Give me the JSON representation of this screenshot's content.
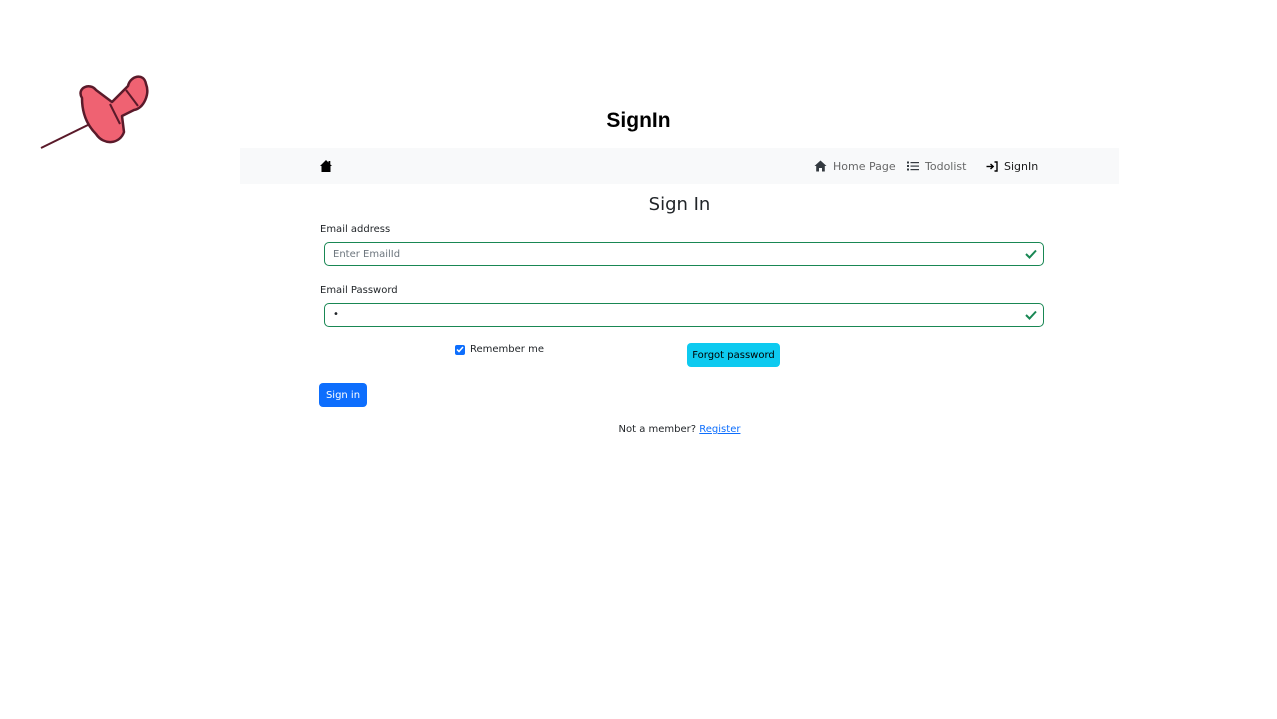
{
  "slide": {
    "title": "SignIn"
  },
  "navbar": {
    "brand_icon": "home-icon",
    "items": [
      {
        "icon": "house-icon",
        "label": "Home Page"
      },
      {
        "icon": "list-icon",
        "label": "Todolist"
      },
      {
        "icon": "sign-in-icon",
        "label": "SignIn",
        "active": true
      }
    ]
  },
  "form": {
    "heading": "Sign In",
    "email": {
      "label": "Email address",
      "placeholder": "Enter EmailId",
      "value": "",
      "valid": true
    },
    "password": {
      "label": "Email Password",
      "value": "•",
      "valid": true
    },
    "remember": {
      "label": "Remember me",
      "checked": true
    },
    "forgot_label": "Forgot password",
    "submit_label": "Sign in",
    "register": {
      "prompt": "Not a member?",
      "link_label": "Register"
    }
  },
  "colors": {
    "primary": "#0d6efd",
    "info": "#0dcaf0",
    "success": "#198754",
    "navbar_bg": "#f8f9fa",
    "pin": "#ef6272"
  }
}
